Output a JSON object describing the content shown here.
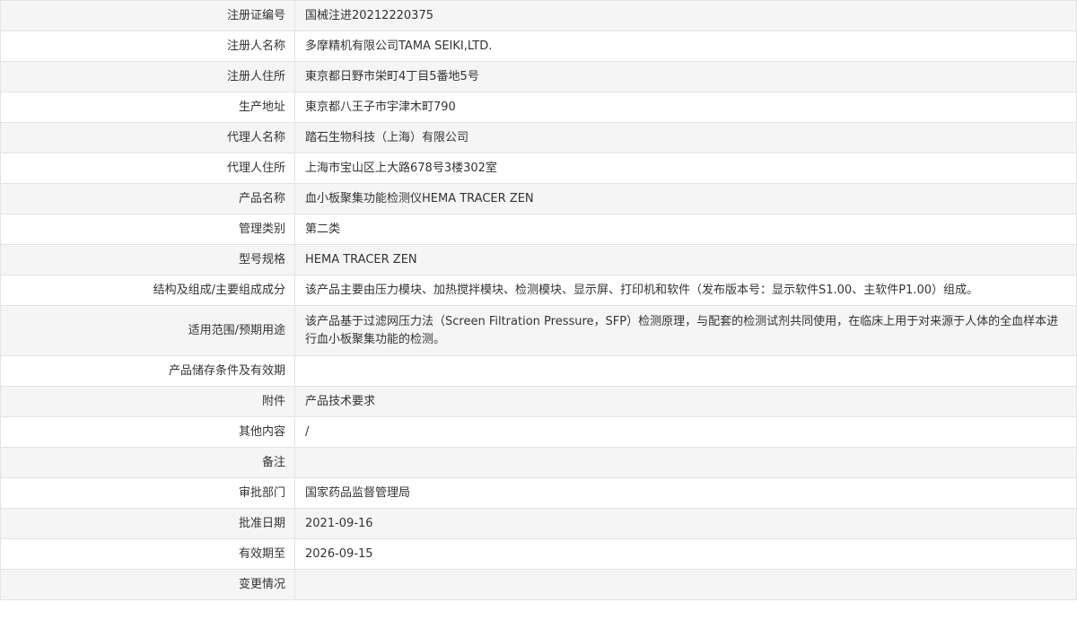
{
  "rows": [
    {
      "label": "注册证编号",
      "value": "国械注进20212220375"
    },
    {
      "label": "注册人名称",
      "value": "多摩精机有限公司TAMA SEIKI,LTD."
    },
    {
      "label": "注册人住所",
      "value": "東京都日野市栄町4丁目5番地5号"
    },
    {
      "label": "生产地址",
      "value": "東京都八王子市宇津木町790"
    },
    {
      "label": "代理人名称",
      "value": "踏石生物科技（上海）有限公司"
    },
    {
      "label": "代理人住所",
      "value": "上海市宝山区上大路678号3楼302室"
    },
    {
      "label": "产品名称",
      "value": "血小板聚集功能检测仪HEMA TRACER ZEN"
    },
    {
      "label": "管理类别",
      "value": "第二类"
    },
    {
      "label": "型号规格",
      "value": "HEMA TRACER ZEN"
    },
    {
      "label": "结构及组成/主要组成成分",
      "value": "该产品主要由压力模块、加热搅拌模块、检测模块、显示屏、打印机和软件（发布版本号：显示软件S1.00、主软件P1.00）组成。"
    },
    {
      "label": "适用范围/预期用途",
      "value": "该产品基于过滤网压力法（Screen Filtration Pressure，SFP）检测原理，与配套的检测试剂共同使用，在临床上用于对来源于人体的全血样本进行血小板聚集功能的检测。"
    },
    {
      "label": "产品储存条件及有效期",
      "value": ""
    },
    {
      "label": "附件",
      "value": "产品技术要求"
    },
    {
      "label": "其他内容",
      "value": "/"
    },
    {
      "label": "备注",
      "value": ""
    },
    {
      "label": "审批部门",
      "value": "国家药品监督管理局"
    },
    {
      "label": "批准日期",
      "value": "2021-09-16"
    },
    {
      "label": "有效期至",
      "value": "2026-09-15"
    },
    {
      "label": "变更情况",
      "value": ""
    }
  ]
}
